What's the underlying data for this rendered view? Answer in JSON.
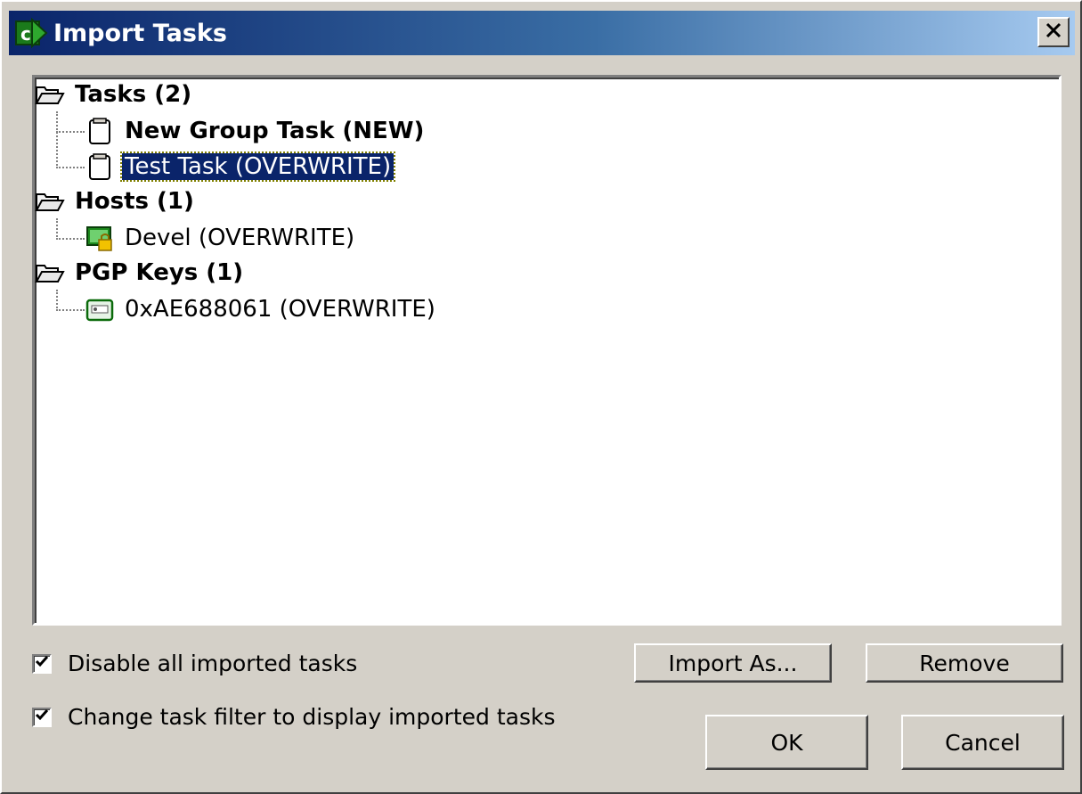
{
  "window": {
    "title": "Import Tasks",
    "app_icon": "green-arrow-c-icon",
    "close_label": "✕"
  },
  "tree": {
    "groups": [
      {
        "label": "Tasks (2)",
        "icon": "open-folder-icon",
        "children": [
          {
            "label": "New Group Task (NEW)",
            "icon": "task-clipboard-icon",
            "bold": true,
            "selected": false
          },
          {
            "label": "Test Task (OVERWRITE)",
            "icon": "task-clipboard-icon",
            "bold": false,
            "selected": true
          }
        ]
      },
      {
        "label": "Hosts (1)",
        "icon": "open-folder-icon",
        "children": [
          {
            "label": "Devel (OVERWRITE)",
            "icon": "locked-host-icon",
            "bold": false,
            "selected": false
          }
        ]
      },
      {
        "label": "PGP Keys (1)",
        "icon": "open-folder-icon",
        "children": [
          {
            "label": "0xAE688061 (OVERWRITE)",
            "icon": "pgp-key-icon",
            "bold": false,
            "selected": false
          }
        ]
      }
    ]
  },
  "options": {
    "disable_imported": {
      "label": "Disable all imported tasks",
      "checked": true
    },
    "change_filter": {
      "label": "Change task filter to display imported tasks",
      "checked": true
    }
  },
  "buttons": {
    "import_as": "Import As...",
    "remove": "Remove",
    "ok": "OK",
    "cancel": "Cancel"
  },
  "colors": {
    "title_gradient_start": "#0a246a",
    "title_gradient_end": "#a6caf0",
    "selection": "#0a246a",
    "dialog_bg": "#d4d0c8"
  }
}
